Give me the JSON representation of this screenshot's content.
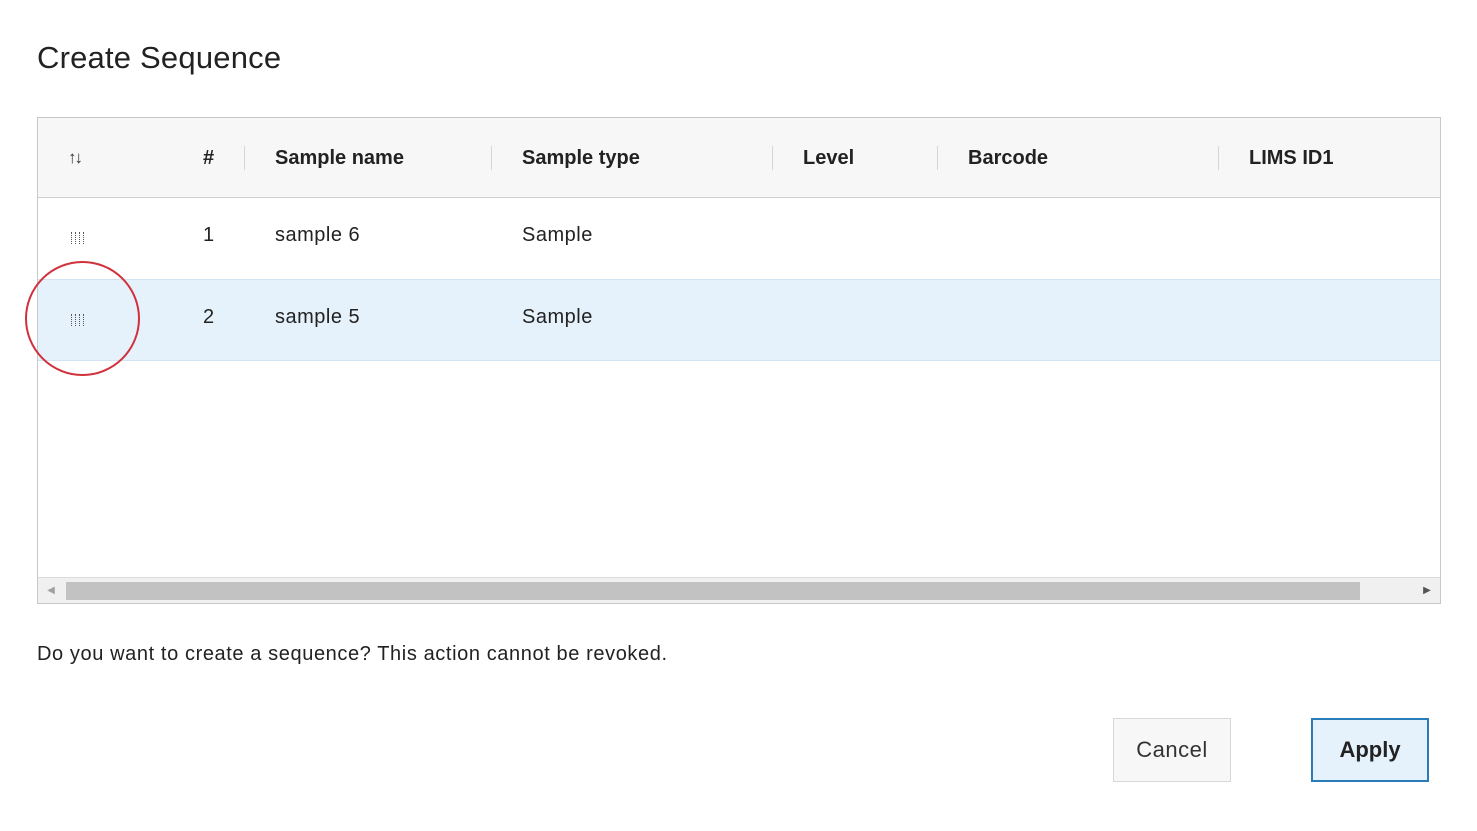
{
  "dialog": {
    "title": "Create Sequence",
    "message": "Do you want to create a sequence? This action cannot be revoked."
  },
  "table": {
    "sort_icon": "↑↓",
    "columns": {
      "index": "#",
      "sample_name": "Sample name",
      "sample_type": "Sample type",
      "level": "Level",
      "barcode": "Barcode",
      "lims_id1": "LIMS ID1"
    },
    "rows": [
      {
        "index": "1",
        "sample_name": "sample 6",
        "sample_type": "Sample",
        "level": "",
        "barcode": "",
        "lims_id1": "",
        "selected": false
      },
      {
        "index": "2",
        "sample_name": "sample 5",
        "sample_type": "Sample",
        "level": "",
        "barcode": "",
        "lims_id1": "",
        "selected": true
      }
    ]
  },
  "buttons": {
    "cancel_label": "Cancel",
    "apply_label": "Apply"
  },
  "icons": {
    "sort": "sort-arrows-icon",
    "drag": "drag-handle-icon",
    "scroll_left": "scroll-left-arrow-icon",
    "scroll_right": "scroll-right-arrow-icon"
  },
  "colors": {
    "selected_row": "#e6f2fb",
    "apply_border": "#2a7cb8",
    "annotation": "#d0313c"
  }
}
